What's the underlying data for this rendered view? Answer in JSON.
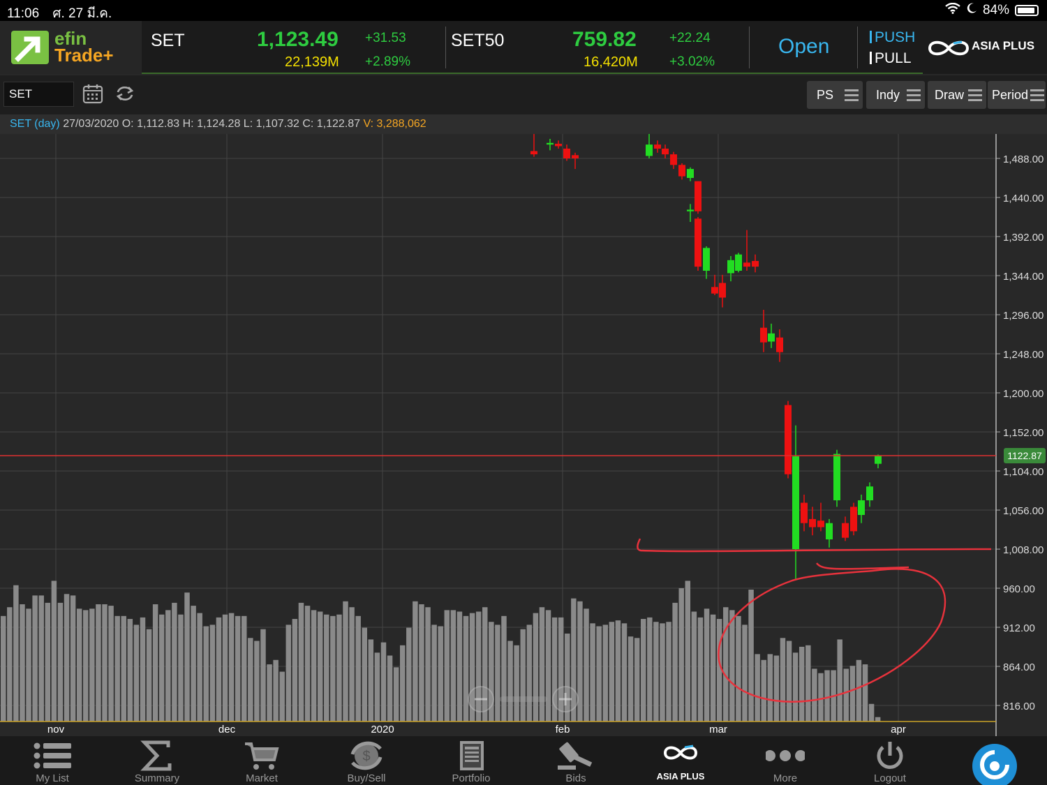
{
  "status": {
    "time": "11:06",
    "date": "ศ. 27 มี.ค.",
    "battery": "84%"
  },
  "header": {
    "logo_line1": "efin",
    "logo_line2": "Trade+",
    "indices": [
      {
        "name": "SET",
        "value": "1,123.49",
        "volume": "22,139M",
        "change": "+31.53",
        "pct": "+2.89%"
      },
      {
        "name": "SET50",
        "value": "759.82",
        "volume": "16,420M",
        "change": "+22.24",
        "pct": "+3.02%"
      }
    ],
    "market_status": "Open",
    "push_label": "PUSH",
    "pull_label": "PULL",
    "broker": "ASIA PLUS"
  },
  "toolbar": {
    "symbol": "SET",
    "buttons": [
      "PS",
      "Indy",
      "Draw",
      "Period"
    ]
  },
  "info": {
    "symbol_period": "SET (day)",
    "date": "27/03/2020",
    "o_label": "O:",
    "o": "1,112.83",
    "h_label": "H:",
    "h": "1,124.28",
    "l_label": "L:",
    "l": "1,107.32",
    "c_label": "C:",
    "c": "1,122.87",
    "v_label": "V:",
    "v": "3,288,062"
  },
  "chart_data": {
    "type": "candlestick",
    "y_ticks": [
      "1,488.00",
      "1,440.00",
      "1,392.00",
      "1,344.00",
      "1,296.00",
      "1,248.00",
      "1,200.00",
      "1,152.00",
      "1,104.00",
      "1,056.00",
      "1,008.00",
      "960.00",
      "912.00",
      "864.00",
      "816.00"
    ],
    "ylim": [
      800,
      1520
    ],
    "x_labels": [
      "nov",
      "dec",
      "2020",
      "feb",
      "mar",
      "apr"
    ],
    "last_price_label": "1122.87",
    "last_price": 1122.87,
    "candles": [
      {
        "o": 1497,
        "h": 1520,
        "l": 1490,
        "c": 1493,
        "up": false
      },
      {
        "o": 1505,
        "h": 1512,
        "l": 1498,
        "c": 1507,
        "up": true
      },
      {
        "o": 1506,
        "h": 1510,
        "l": 1500,
        "c": 1503,
        "up": false
      },
      {
        "o": 1500,
        "h": 1505,
        "l": 1485,
        "c": 1488,
        "up": false
      },
      {
        "o": 1488,
        "h": 1495,
        "l": 1475,
        "c": 1492,
        "up": false
      },
      {
        "o": 1491,
        "h": 1518,
        "l": 1488,
        "c": 1505,
        "up": true
      },
      {
        "o": 1505,
        "h": 1510,
        "l": 1495,
        "c": 1500,
        "up": false
      },
      {
        "o": 1500,
        "h": 1505,
        "l": 1488,
        "c": 1493,
        "up": false
      },
      {
        "o": 1493,
        "h": 1496,
        "l": 1475,
        "c": 1480,
        "up": false
      },
      {
        "o": 1480,
        "h": 1482,
        "l": 1462,
        "c": 1466,
        "up": false
      },
      {
        "o": 1464,
        "h": 1477,
        "l": 1460,
        "c": 1475,
        "up": true
      },
      {
        "o": 1460,
        "h": 1460,
        "l": 1420,
        "c": 1423,
        "up": false
      },
      {
        "o": 1423,
        "h": 1432,
        "l": 1410,
        "c": 1425,
        "up": true
      },
      {
        "o": 1414,
        "h": 1416,
        "l": 1350,
        "c": 1355,
        "up": false
      },
      {
        "o": 1350,
        "h": 1380,
        "l": 1340,
        "c": 1378,
        "up": true
      },
      {
        "o": 1330,
        "h": 1345,
        "l": 1320,
        "c": 1322,
        "up": false
      },
      {
        "o": 1335,
        "h": 1345,
        "l": 1305,
        "c": 1317,
        "up": false
      },
      {
        "o": 1347,
        "h": 1368,
        "l": 1337,
        "c": 1363,
        "up": true
      },
      {
        "o": 1350,
        "h": 1372,
        "l": 1348,
        "c": 1370,
        "up": true
      },
      {
        "o": 1360,
        "h": 1400,
        "l": 1350,
        "c": 1355,
        "up": false
      },
      {
        "o": 1362,
        "h": 1370,
        "l": 1348,
        "c": 1355,
        "up": false
      },
      {
        "o": 1280,
        "h": 1302,
        "l": 1250,
        "c": 1262,
        "up": false
      },
      {
        "o": 1263,
        "h": 1285,
        "l": 1255,
        "c": 1273,
        "up": true
      },
      {
        "o": 1268,
        "h": 1278,
        "l": 1238,
        "c": 1250,
        "up": false
      },
      {
        "o": 1185,
        "h": 1190,
        "l": 1095,
        "c": 1100,
        "up": false
      },
      {
        "o": 1008,
        "h": 1160,
        "l": 970,
        "c": 1122,
        "up": true
      },
      {
        "o": 1065,
        "h": 1075,
        "l": 1030,
        "c": 1040,
        "up": false
      },
      {
        "o": 1045,
        "h": 1060,
        "l": 1025,
        "c": 1035,
        "up": false
      },
      {
        "o": 1043,
        "h": 1065,
        "l": 1030,
        "c": 1035,
        "up": false
      },
      {
        "o": 1020,
        "h": 1045,
        "l": 1010,
        "c": 1040,
        "up": true
      },
      {
        "o": 1068,
        "h": 1130,
        "l": 1060,
        "c": 1125,
        "up": true
      },
      {
        "o": 1040,
        "h": 1048,
        "l": 1018,
        "c": 1022,
        "up": false
      },
      {
        "o": 1060,
        "h": 1065,
        "l": 1025,
        "c": 1030,
        "up": false
      },
      {
        "o": 1050,
        "h": 1075,
        "l": 1040,
        "c": 1068,
        "up": true
      },
      {
        "o": 1068,
        "h": 1090,
        "l": 1060,
        "c": 1085,
        "up": true
      },
      {
        "o": 1112.83,
        "h": 1124.28,
        "l": 1107.32,
        "c": 1122.87,
        "up": true
      }
    ],
    "volumes": [
      0.72,
      0.78,
      0.93,
      0.8,
      0.77,
      0.86,
      0.86,
      0.81,
      0.96,
      0.81,
      0.87,
      0.86,
      0.77,
      0.76,
      0.77,
      0.8,
      0.8,
      0.79,
      0.72,
      0.72,
      0.7,
      0.66,
      0.71,
      0.63,
      0.8,
      0.73,
      0.76,
      0.81,
      0.73,
      0.88,
      0.79,
      0.74,
      0.65,
      0.66,
      0.71,
      0.73,
      0.74,
      0.72,
      0.72,
      0.57,
      0.55,
      0.63,
      0.39,
      0.42,
      0.34,
      0.66,
      0.7,
      0.81,
      0.79,
      0.76,
      0.75,
      0.73,
      0.72,
      0.73,
      0.82,
      0.78,
      0.72,
      0.64,
      0.56,
      0.47,
      0.54,
      0.45,
      0.37,
      0.52,
      0.64,
      0.82,
      0.8,
      0.78,
      0.66,
      0.65,
      0.76,
      0.76,
      0.75,
      0.72,
      0.74,
      0.75,
      0.78,
      0.68,
      0.66,
      0.72,
      0.55,
      0.52,
      0.63,
      0.66,
      0.74,
      0.78,
      0.76,
      0.71,
      0.71,
      0.6,
      0.84,
      0.82,
      0.77,
      0.67,
      0.65,
      0.66,
      0.68,
      0.69,
      0.67,
      0.58,
      0.57,
      0.7,
      0.71,
      0.68,
      0.67,
      0.68,
      0.81,
      0.91,
      0.96,
      0.75,
      0.71,
      0.77,
      0.73,
      0.7,
      0.78,
      0.76,
      0.72,
      0.66,
      0.9,
      0.46,
      0.42,
      0.46,
      0.45,
      0.57,
      0.55,
      0.47,
      0.51,
      0.52,
      0.36,
      0.33,
      0.35,
      0.35,
      0.56,
      0.36,
      0.38,
      0.42,
      0.39,
      0.12,
      0.03
    ],
    "vol_ylim": [
      0,
      1
    ]
  },
  "nav": [
    {
      "label": "My List",
      "icon": "list-icon"
    },
    {
      "label": "Summary",
      "icon": "sigma-icon"
    },
    {
      "label": "Market",
      "icon": "cart-icon"
    },
    {
      "label": "Buy/Sell",
      "icon": "buysell-icon"
    },
    {
      "label": "Portfolio",
      "icon": "portfolio-icon"
    },
    {
      "label": "Bids",
      "icon": "gavel-icon"
    },
    {
      "label": "ASIA PLUS",
      "icon": "asiaplus-icon"
    },
    {
      "label": "More",
      "icon": "more-icon"
    },
    {
      "label": "Logout",
      "icon": "power-icon"
    }
  ],
  "colors": {
    "up": "#22dd22",
    "down": "#ee1111",
    "bg": "#282828",
    "grid": "#444444",
    "annotation": "#e8323c",
    "accent": "#39b7f0"
  }
}
